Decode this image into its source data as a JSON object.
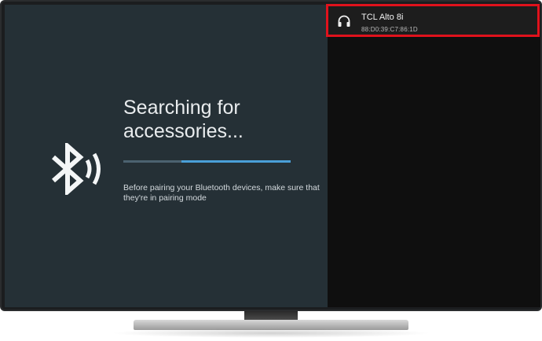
{
  "search": {
    "title": "Searching for accessories...",
    "hint": "Before pairing your Bluetooth devices, make sure that they're in pairing mode",
    "progress_indeterminate": true
  },
  "devices": [
    {
      "name": "TCL Alto 8i",
      "address": "88:D0:39:C7:86:1D",
      "icon": "headphones-icon",
      "highlighted": true
    }
  ],
  "colors": {
    "left_panel_bg": "#253036",
    "right_panel_bg": "#0f0f0f",
    "progress_accent": "#4a9fd8",
    "highlight_border": "#e0121c"
  },
  "icons": {
    "status_icon": "bluetooth-searching-icon"
  }
}
